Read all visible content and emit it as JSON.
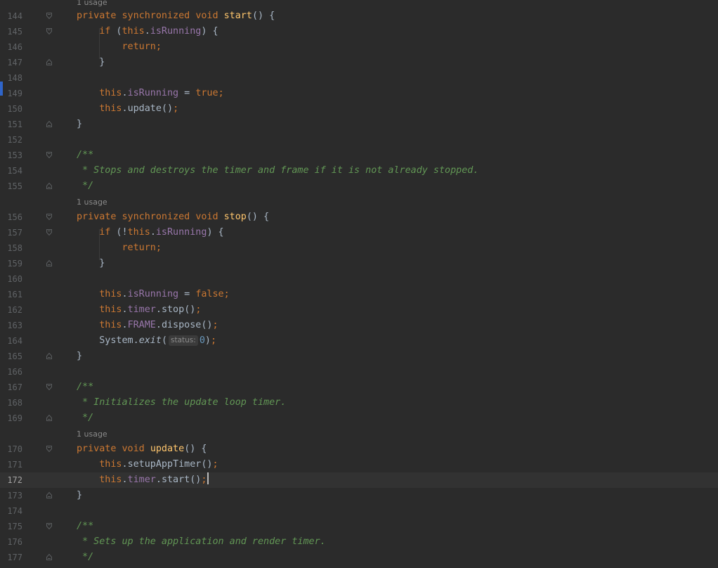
{
  "editor": {
    "language": "Java",
    "theme_colors": {
      "background": "#2b2b2b",
      "current_line": "#323232",
      "keyword": "#cc7832",
      "method": "#ffc66d",
      "field": "#9876aa",
      "doc_comment": "#629755",
      "number": "#6897bb",
      "identifier": "#a9b7c6",
      "line_number": "#606366"
    },
    "usage_hints": [
      "1 usage",
      "1 usage",
      "1 usage"
    ],
    "parameter_hint": "status:",
    "current_line_number": "172",
    "lines": [
      {
        "n": "144",
        "code": "private synchronized void start() {"
      },
      {
        "n": "145",
        "code": "    if (this.isRunning) {"
      },
      {
        "n": "146",
        "code": "        return;"
      },
      {
        "n": "147",
        "code": "    }"
      },
      {
        "n": "148",
        "code": ""
      },
      {
        "n": "149",
        "code": "    this.isRunning = true;"
      },
      {
        "n": "150",
        "code": "    this.update();"
      },
      {
        "n": "151",
        "code": "}"
      },
      {
        "n": "152",
        "code": ""
      },
      {
        "n": "153",
        "code": "/**"
      },
      {
        "n": "154",
        "code": " * Stops and destroys the timer and frame if it is not already stopped."
      },
      {
        "n": "155",
        "code": " */"
      },
      {
        "n": "156",
        "code": "private synchronized void stop() {"
      },
      {
        "n": "157",
        "code": "    if (!this.isRunning) {"
      },
      {
        "n": "158",
        "code": "        return;"
      },
      {
        "n": "159",
        "code": "    }"
      },
      {
        "n": "160",
        "code": ""
      },
      {
        "n": "161",
        "code": "    this.isRunning = false;"
      },
      {
        "n": "162",
        "code": "    this.timer.stop();"
      },
      {
        "n": "163",
        "code": "    this.FRAME.dispose();"
      },
      {
        "n": "164",
        "code": "    System.exit( status: 0);"
      },
      {
        "n": "165",
        "code": "}"
      },
      {
        "n": "166",
        "code": ""
      },
      {
        "n": "167",
        "code": "/**"
      },
      {
        "n": "168",
        "code": " * Initializes the update loop timer."
      },
      {
        "n": "169",
        "code": " */"
      },
      {
        "n": "170",
        "code": "private void update() {"
      },
      {
        "n": "171",
        "code": "    this.setupAppTimer();"
      },
      {
        "n": "172",
        "code": "    this.timer.start();"
      },
      {
        "n": "173",
        "code": "}"
      },
      {
        "n": "174",
        "code": ""
      },
      {
        "n": "175",
        "code": "/**"
      },
      {
        "n": "176",
        "code": " * Sets up the application and render timer."
      },
      {
        "n": "177",
        "code": " */"
      }
    ]
  },
  "tokens": {
    "private": "private",
    "synchronized": "synchronized",
    "void": "void",
    "if": "if",
    "this": "this",
    "return": "return;",
    "true": "true",
    "false": "false",
    "start": "start",
    "stop": "stop",
    "update": "update",
    "isRunning": "isRunning",
    "timer": "timer",
    "FRAME": "FRAME",
    "dispose": "dispose",
    "System": "System",
    "exit": "exit",
    "setupAppTimer": "setupAppTimer",
    "zero": "0",
    "doc_open": "/**",
    "doc_close": " */",
    "doc_stop": " * Stops and destroys the timer and frame if it is not already stopped.",
    "doc_init": " * Initializes the update loop timer.",
    "doc_setup": " * Sets up the application and render timer."
  }
}
